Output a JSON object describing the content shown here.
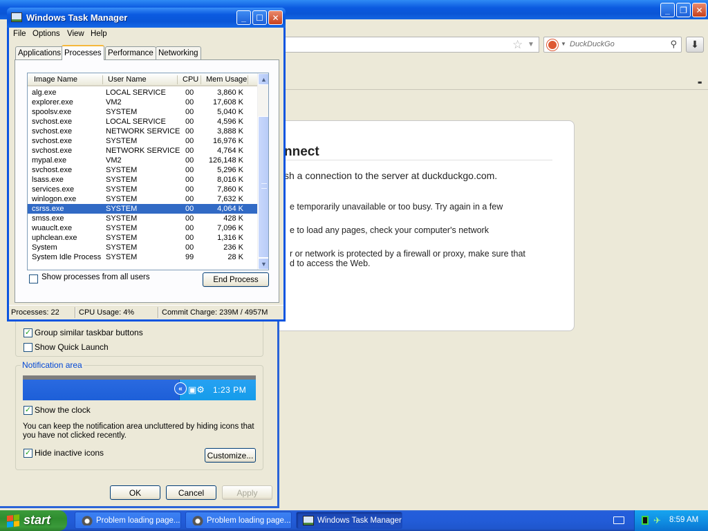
{
  "firefox": {
    "search_engine": "DuckDuckGo",
    "error": {
      "title_fragment": "nnect",
      "desc_fragment": "sh a connection to the server at duckduckgo.com.",
      "lines": [
        "e temporarily unavailable or too busy. Try again in a few",
        "e to load any pages, check your computer's network",
        "r or network is protected by a firewall or proxy, make sure that",
        "d to access the Web."
      ]
    }
  },
  "props_dialog": {
    "group_similar_label": "Group similar taskbar buttons",
    "group_similar_checked": true,
    "quick_launch_label": "Show Quick Launch",
    "quick_launch_checked": false,
    "notification_legend": "Notification area",
    "preview_time": "1:23 PM",
    "show_clock_label": "Show the clock",
    "show_clock_checked": true,
    "notif_desc": "You can keep the notification area uncluttered by hiding icons that you have not clicked recently.",
    "hide_inactive_label": "Hide inactive icons",
    "hide_inactive_checked": true,
    "customize_label": "Customize...",
    "ok_label": "OK",
    "cancel_label": "Cancel",
    "apply_label": "Apply"
  },
  "task_manager": {
    "title": "Windows Task Manager",
    "menu": [
      "File",
      "Options",
      "View",
      "Help"
    ],
    "tabs": [
      "Applications",
      "Processes",
      "Performance",
      "Networking"
    ],
    "active_tab": "Processes",
    "columns": [
      "Image Name",
      "User Name",
      "CPU",
      "Mem Usage"
    ],
    "processes": [
      {
        "name": "alg.exe",
        "user": "LOCAL SERVICE",
        "cpu": "00",
        "mem": "3,860 K"
      },
      {
        "name": "explorer.exe",
        "user": "VM2",
        "cpu": "00",
        "mem": "17,608 K"
      },
      {
        "name": "spoolsv.exe",
        "user": "SYSTEM",
        "cpu": "00",
        "mem": "5,040 K"
      },
      {
        "name": "svchost.exe",
        "user": "LOCAL SERVICE",
        "cpu": "00",
        "mem": "4,596 K"
      },
      {
        "name": "svchost.exe",
        "user": "NETWORK SERVICE",
        "cpu": "00",
        "mem": "3,888 K"
      },
      {
        "name": "svchost.exe",
        "user": "SYSTEM",
        "cpu": "00",
        "mem": "16,976 K"
      },
      {
        "name": "svchost.exe",
        "user": "NETWORK SERVICE",
        "cpu": "00",
        "mem": "4,764 K"
      },
      {
        "name": "mypal.exe",
        "user": "VM2",
        "cpu": "00",
        "mem": "126,148 K"
      },
      {
        "name": "svchost.exe",
        "user": "SYSTEM",
        "cpu": "00",
        "mem": "5,296 K"
      },
      {
        "name": "lsass.exe",
        "user": "SYSTEM",
        "cpu": "00",
        "mem": "8,016 K"
      },
      {
        "name": "services.exe",
        "user": "SYSTEM",
        "cpu": "00",
        "mem": "7,860 K"
      },
      {
        "name": "winlogon.exe",
        "user": "SYSTEM",
        "cpu": "00",
        "mem": "7,632 K"
      },
      {
        "name": "csrss.exe",
        "user": "SYSTEM",
        "cpu": "00",
        "mem": "4,064 K",
        "selected": true
      },
      {
        "name": "smss.exe",
        "user": "SYSTEM",
        "cpu": "00",
        "mem": "428 K"
      },
      {
        "name": "wuauclt.exe",
        "user": "SYSTEM",
        "cpu": "00",
        "mem": "7,096 K"
      },
      {
        "name": "uphclean.exe",
        "user": "SYSTEM",
        "cpu": "00",
        "mem": "1,316 K"
      },
      {
        "name": "System",
        "user": "SYSTEM",
        "cpu": "00",
        "mem": "236 K"
      },
      {
        "name": "System Idle Process",
        "user": "SYSTEM",
        "cpu": "99",
        "mem": "28 K"
      }
    ],
    "show_all_label": "Show processes from all users",
    "show_all_checked": false,
    "end_process_label": "End Process",
    "status": {
      "processes": "Processes: 22",
      "cpu": "CPU Usage: 4%",
      "commit": "Commit Charge: 239M / 4957M"
    }
  },
  "taskbar": {
    "start_label": "start",
    "tasks": [
      {
        "label": "Problem loading page...",
        "active": false
      },
      {
        "label": "Problem loading page...",
        "active": false
      },
      {
        "label": "Windows Task Manager",
        "active": true
      }
    ],
    "clock": "8:59 AM"
  },
  "colors": {
    "xp_blue": "#0b55e0",
    "selection": "#316ac5",
    "start_green": "#3c9b3c",
    "check_green": "#21a121"
  }
}
